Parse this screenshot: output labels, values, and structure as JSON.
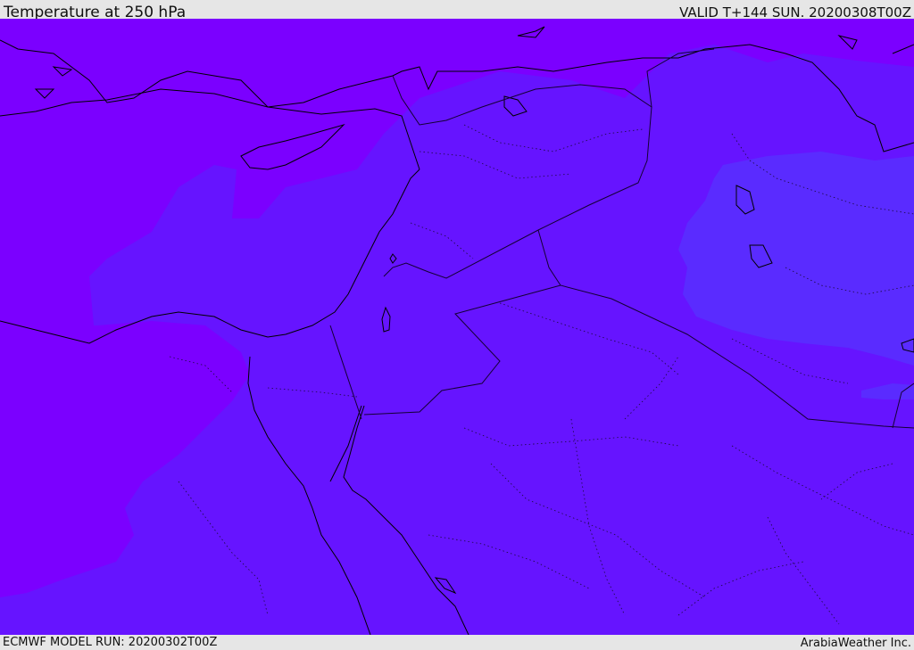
{
  "header": {
    "title": "Temperature at 250 hPa",
    "valid": "VALID T+144 SUN. 20200308T00Z"
  },
  "footer": {
    "model_run": "ECMWF MODEL RUN: 20200302T00Z",
    "credit": "ArabiaWeather Inc."
  },
  "map": {
    "colors": {
      "cold_band": "#7b00ff",
      "mid_band": "#6614ff",
      "warm_band": "#5a2bff",
      "coastline": "#000000",
      "border": "#1a0a3a"
    }
  }
}
